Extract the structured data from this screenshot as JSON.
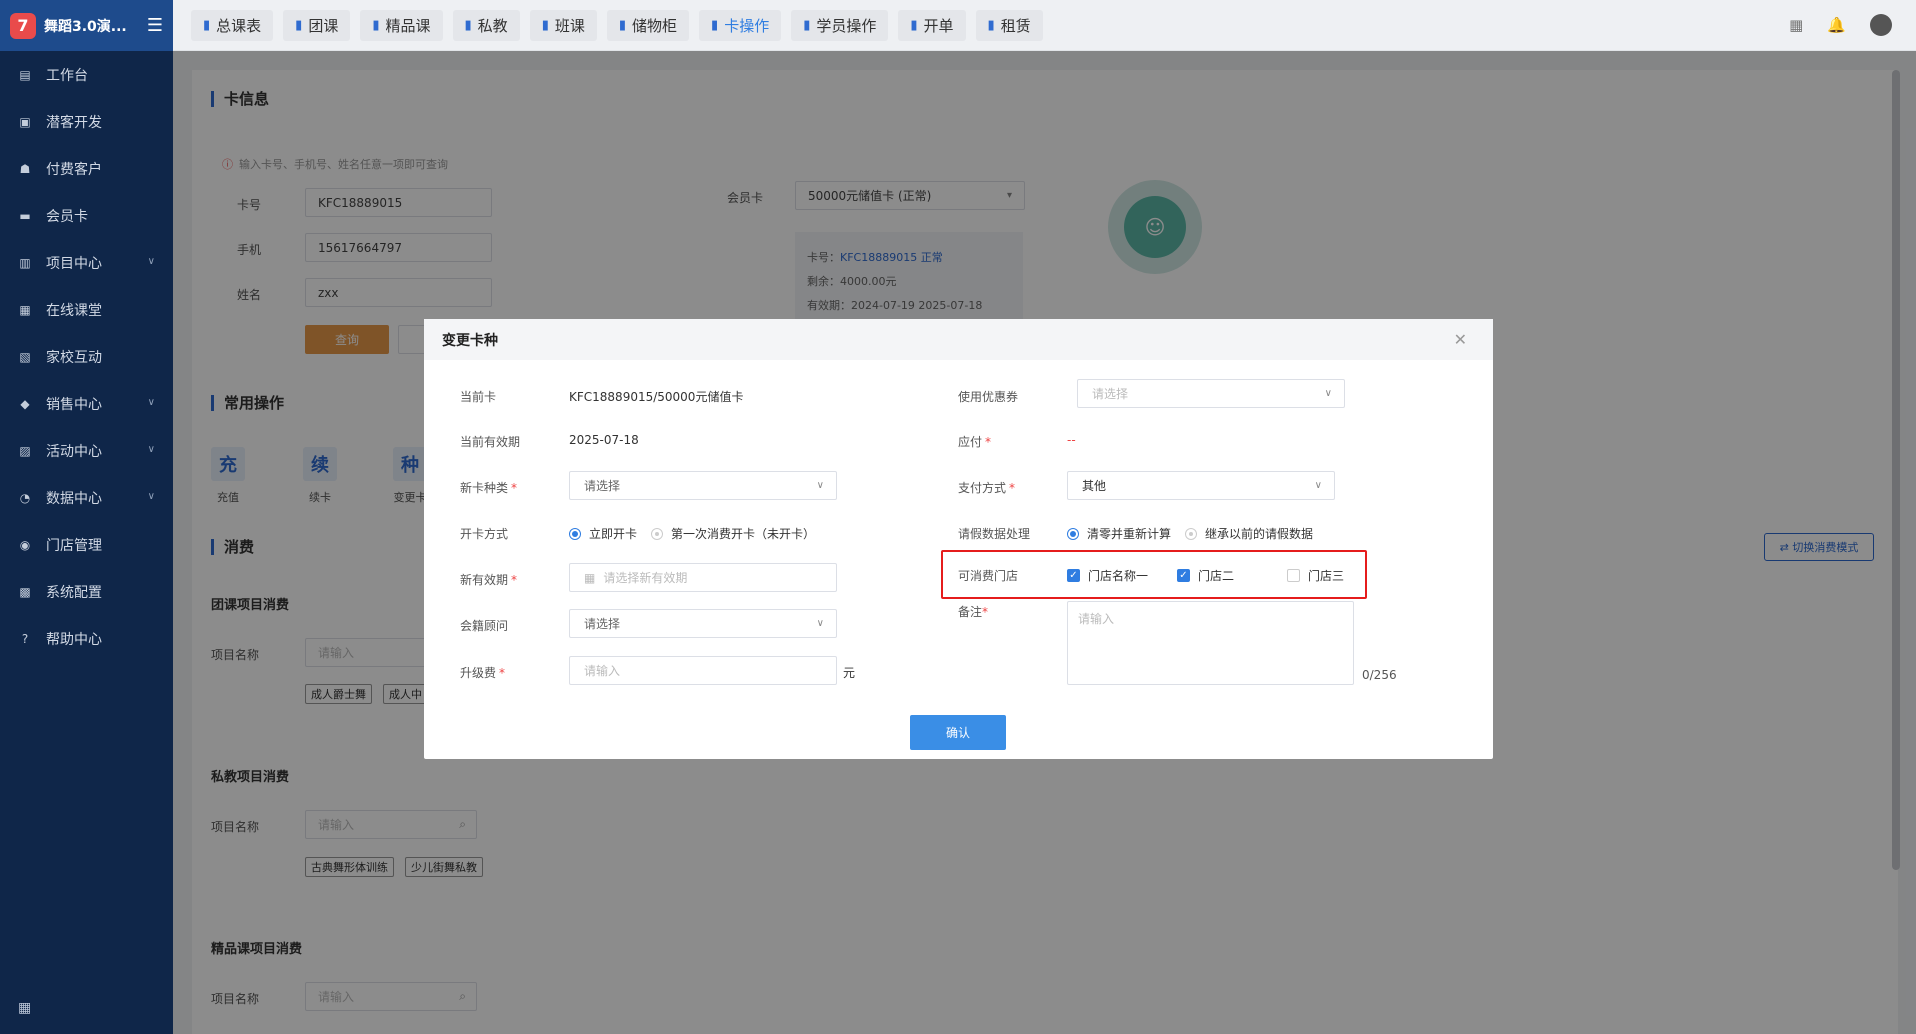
{
  "app": {
    "name": "舞蹈3.0演...",
    "logo_char": "7"
  },
  "sidebar": {
    "items": [
      {
        "label": "工作台",
        "icon": "▤",
        "arrow": false
      },
      {
        "label": "潜客开发",
        "icon": "▣",
        "arrow": false
      },
      {
        "label": "付费客户",
        "icon": "☗",
        "arrow": false
      },
      {
        "label": "会员卡",
        "icon": "▬",
        "arrow": false
      },
      {
        "label": "项目中心",
        "icon": "▥",
        "arrow": true
      },
      {
        "label": "在线课堂",
        "icon": "▦",
        "arrow": false
      },
      {
        "label": "家校互动",
        "icon": "▧",
        "arrow": false
      },
      {
        "label": "销售中心",
        "icon": "◆",
        "arrow": true
      },
      {
        "label": "活动中心",
        "icon": "▨",
        "arrow": true
      },
      {
        "label": "数据中心",
        "icon": "◔",
        "arrow": true
      },
      {
        "label": "门店管理",
        "icon": "◉",
        "arrow": false
      },
      {
        "label": "系统配置",
        "icon": "▩",
        "arrow": false
      },
      {
        "label": "帮助中心",
        "icon": "?",
        "arrow": false
      }
    ]
  },
  "topnav": {
    "tabs": [
      {
        "label": "总课表"
      },
      {
        "label": "团课"
      },
      {
        "label": "精品课"
      },
      {
        "label": "私教"
      },
      {
        "label": "班课"
      },
      {
        "label": "储物柜"
      },
      {
        "label": "卡操作"
      },
      {
        "label": "学员操作"
      },
      {
        "label": "开单"
      },
      {
        "label": "租赁"
      }
    ]
  },
  "cardinfo": {
    "title": "卡信息",
    "hint": "输入卡号、手机号、姓名任意一项即可查询",
    "card_no_label": "卡号",
    "card_no": "KFC18889015",
    "phone_label": "手机",
    "phone": "15617664797",
    "name_label": "姓名",
    "name": "zxx",
    "query_btn": "查询",
    "member_card_label": "会员卡",
    "member_card_value": "50000元储值卡 (正常)",
    "info_card_prefix": "卡号：",
    "info_card_value": "KFC18889015 正常",
    "info_balance": "剩余：4000.00元",
    "info_valid": "有效期：2024-07-19 2025-07-18"
  },
  "ops": {
    "title": "常用操作",
    "items": [
      {
        "char": "充",
        "label": "充值"
      },
      {
        "char": "续",
        "label": "续卡"
      },
      {
        "char": "种",
        "label": "变更卡"
      }
    ]
  },
  "consume": {
    "title": "消费",
    "switch_btn": "⇄ 切换消费模式",
    "group": {
      "title": "团课项目消费",
      "label": "项目名称",
      "placeholder": "请输入",
      "tags": [
        "成人爵士舞",
        "成人中"
      ]
    },
    "private": {
      "title": "私教项目消费",
      "label": "项目名称",
      "placeholder": "请输入",
      "tags": [
        "古典舞形体训练",
        "少儿街舞私教"
      ]
    },
    "premium": {
      "title": "精品课项目消费",
      "label": "项目名称",
      "placeholder": "请输入"
    }
  },
  "dialog": {
    "title": "变更卡种",
    "current_card_label": "当前卡",
    "current_card": "KFC18889015/50000元储值卡",
    "current_valid_label": "当前有效期",
    "current_valid": "2025-07-18",
    "new_type_label": "新卡种类",
    "new_type_placeholder": "请选择",
    "open_mode_label": "开卡方式",
    "open_mode_opt1": "立即开卡",
    "open_mode_opt2": "第一次消费开卡（未开卡）",
    "new_valid_label": "新有效期",
    "new_valid_placeholder": "请选择新有效期",
    "advisor_label": "会籍顾问",
    "advisor_placeholder": "请选择",
    "upgrade_fee_label": "升级费",
    "upgrade_fee_placeholder": "请输入",
    "upgrade_fee_unit": "元",
    "coupon_label": "使用优惠券",
    "coupon_placeholder": "请选择",
    "payable_label": "应付",
    "payable_value": "--",
    "pay_method_label": "支付方式",
    "pay_method_value": "其他",
    "leave_label": "请假数据处理",
    "leave_opt1": "清零并重新计算",
    "leave_opt2": "继承以前的请假数据",
    "stores_label": "可消费门店",
    "store1": "门店名称一",
    "store2": "门店二",
    "store3": "门店三",
    "remark_label": "备注",
    "remark_placeholder": "请输入",
    "remark_counter": "0/256",
    "confirm_btn": "确认"
  },
  "colors": {
    "accent": "#2f7de1",
    "sidebar": "#0f2649",
    "highlight": "#e51c1c",
    "orange": "#e7994a"
  }
}
